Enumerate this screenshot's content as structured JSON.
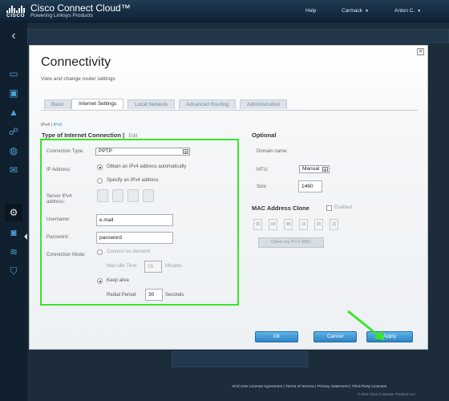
{
  "header": {
    "brand": "CISCO",
    "app_title": "Cisco Connect Cloud™",
    "app_subtitle": "Powering Linksys Products",
    "help": "Help",
    "router_name": "Carmack",
    "user_name": "Anton C."
  },
  "modal": {
    "title": "Connectivity",
    "subtitle": "View and change router settings",
    "close": "✕",
    "tabs": [
      "Basic",
      "Internet Settings",
      "Local Network",
      "Advanced Routing",
      "Administration"
    ],
    "active_tab": "Internet Settings",
    "ip_versions": [
      "IPv4",
      "IPv6"
    ],
    "ip_separator": "|"
  },
  "connection": {
    "title": "Type of Internet Connection",
    "separator": "|",
    "edit": "Edit",
    "type_label": "Connection Type:",
    "type_value": "PPTP",
    "ip_label": "IP Address:",
    "ip_option_auto": "Obtain an IPv4 address automatically",
    "ip_option_manual": "Specify an IPv4 address",
    "ip_selected": "auto",
    "server_label": "Server IPv4 address:",
    "username_label": "Username:",
    "username_value": "e.mail",
    "password_label": "Password:",
    "password_value": "password",
    "mode_label": "Connection Mode:",
    "mode_demand": "Connect on demand",
    "max_idle_label": "Max Idle Time:",
    "max_idle_value": "15",
    "minutes": "Minutes",
    "mode_keep": "Keep alive",
    "redial_label": "Redial Period:",
    "redial_value": "30",
    "seconds": "Seconds",
    "mode_selected": "keep_alive"
  },
  "optional": {
    "title": "Optional",
    "domain_label": "Domain name:",
    "mtu_label": "MTU:",
    "mtu_value": "Manual",
    "size_label": "Size:",
    "size_value": "1460",
    "mac_title": "MAC Address Clone",
    "mac_enabled_label": "Enabled",
    "mac_enabled": false,
    "mac_segments": [
      "00",
      "04",
      "4B",
      "16",
      "00",
      "15"
    ],
    "clone_button": "Clone my PC's MAC"
  },
  "buttons": {
    "ok": "Ok",
    "cancel": "Cancel",
    "apply": "Apply"
  },
  "footer": {
    "links": "End User License Agreement  |  Terms of Service  |  Privacy Statement  |  Third Party Licenses",
    "copyright": "© 2012 Cisco Consumer Products LLC"
  },
  "colors": {
    "highlight": "#39e62a",
    "accent": "#2d83c4"
  }
}
